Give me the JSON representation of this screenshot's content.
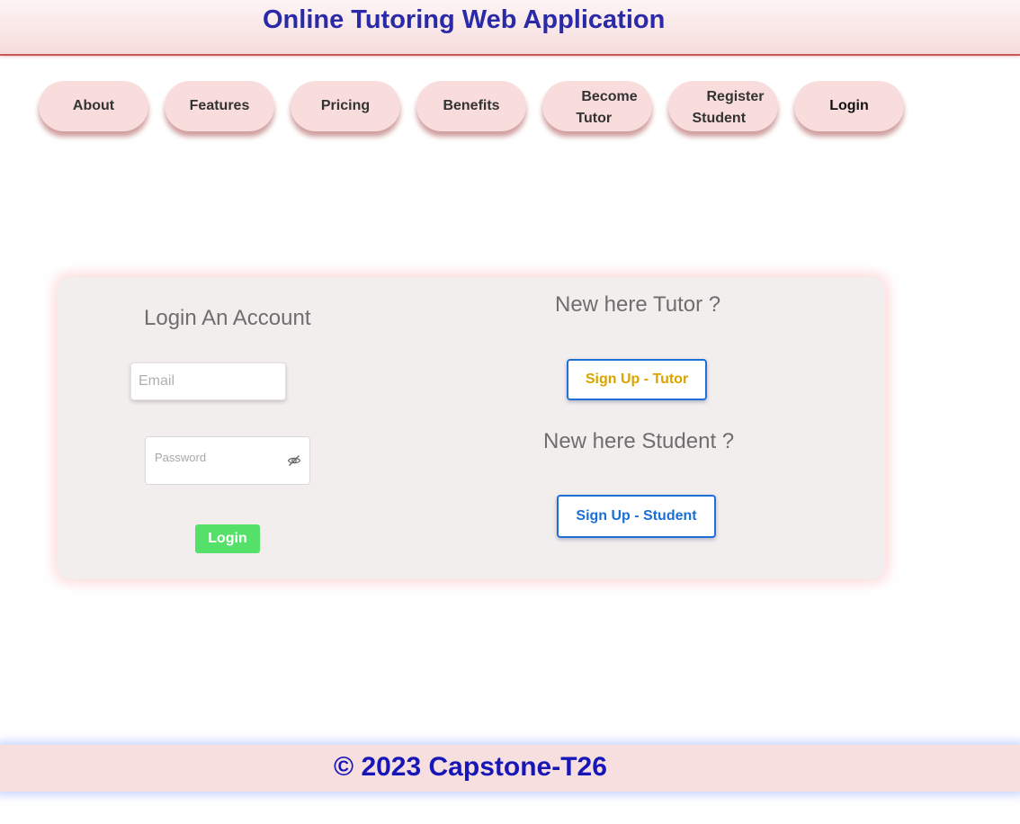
{
  "header": {
    "title": "Online Tutoring Web Application"
  },
  "nav": {
    "about": "About",
    "features": "Features",
    "pricing": "Pricing",
    "benefits": "Benefits",
    "become_tutor_line1": "Become",
    "become_tutor_line2": "Tutor",
    "register_student_line1": "Register",
    "register_student_line2": "Student",
    "login": "Login"
  },
  "login_form": {
    "heading": "Login An Account",
    "email_placeholder": "Email",
    "email_value": "",
    "password_placeholder": "Password",
    "password_value": "",
    "login_label": "Login",
    "eye_icon": "eye-slash-icon"
  },
  "signup": {
    "tutor_heading": "New here Tutor ?",
    "tutor_button": "Sign Up - Tutor",
    "student_heading": "New here Student ?",
    "student_button": "Sign Up - Student"
  },
  "footer": {
    "copyright": "© 2023 Capstone-T26"
  },
  "colors": {
    "title": "#2a2aa8",
    "nav_bg": "#f9dcdc",
    "login_button": "#55e06a",
    "tutor_button_text": "#d9a400",
    "student_button_text": "#1a6fd4",
    "footer_text": "#1717b8"
  }
}
